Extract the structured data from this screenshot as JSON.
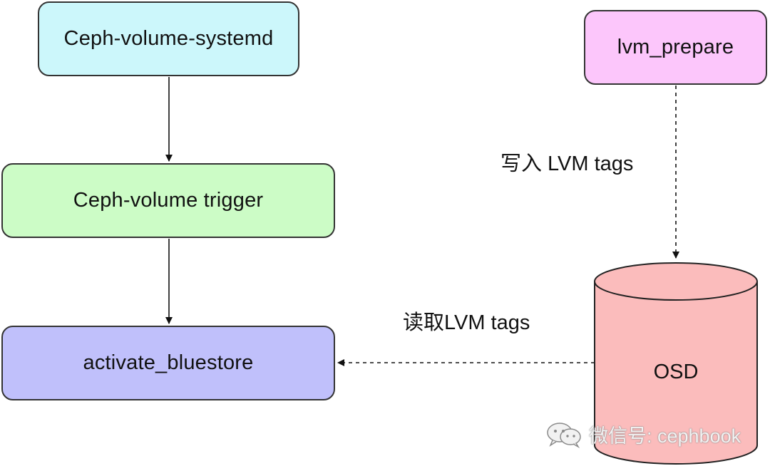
{
  "nodes": {
    "systemd": {
      "label": "Ceph-volume-systemd",
      "fill": "#ccf7fb"
    },
    "trigger": {
      "label": "Ceph-volume trigger",
      "fill": "#ccfcc6"
    },
    "activate": {
      "label": "activate_bluestore",
      "fill": "#c0c0fb"
    },
    "prepare": {
      "label": "lvm_prepare",
      "fill": "#fcc6fb"
    },
    "osd": {
      "label": "OSD",
      "fill": "#fbbcbc"
    }
  },
  "edges": {
    "write_label": "写入 LVM tags",
    "read_label": "读取LVM tags"
  },
  "watermark": {
    "text": "微信号: cephbook",
    "icon": "wechat-icon"
  }
}
